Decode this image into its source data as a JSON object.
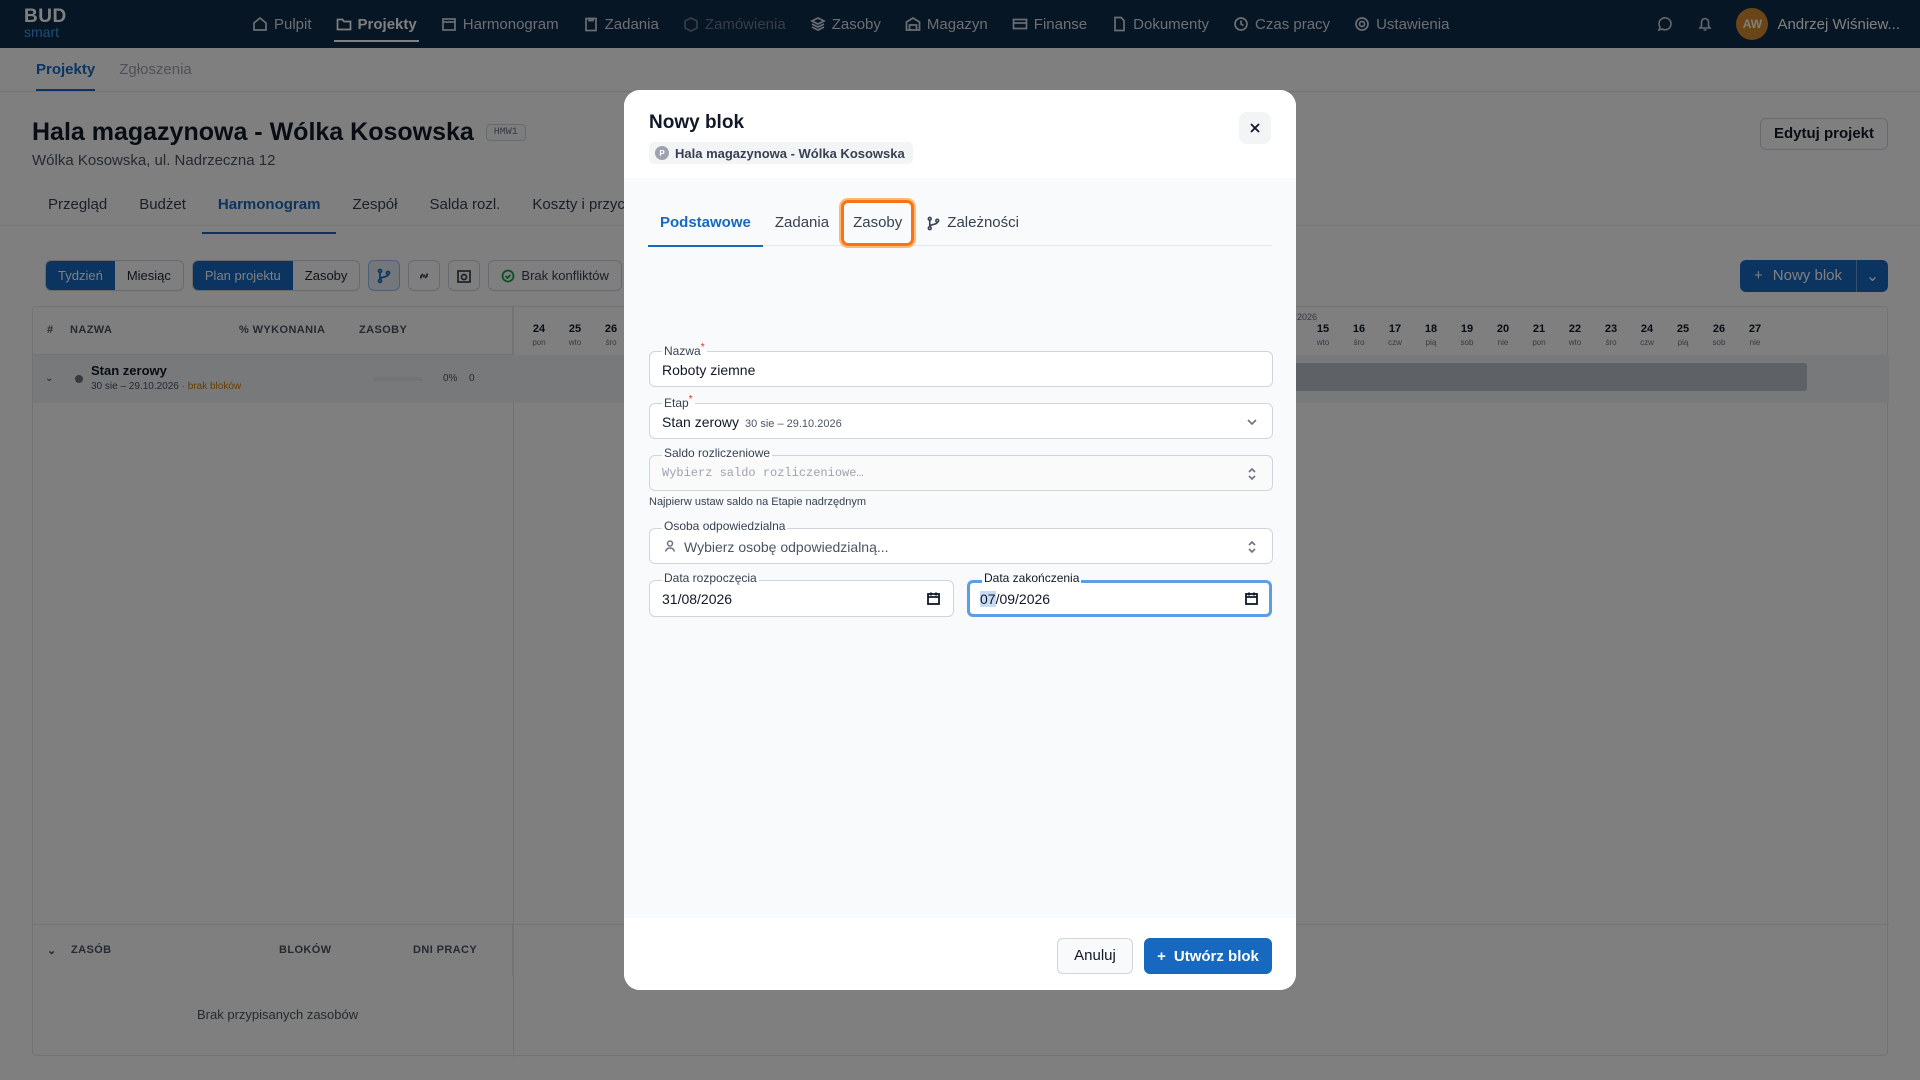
{
  "app": {
    "logo_top": "BUD",
    "logo_bottom": "smart",
    "user_initials": "AW",
    "user_name": "Andrzej Wiśniew..."
  },
  "nav": [
    "Pulpit",
    "Projekty",
    "Harmonogram",
    "Zadania",
    "Zamówienia",
    "Zasoby",
    "Magazyn",
    "Finanse",
    "Dokumenty",
    "Czas pracy",
    "Ustawienia"
  ],
  "subnav": [
    "Projekty",
    "Zgłoszenia"
  ],
  "project": {
    "title": "Hala magazynowa - Wólka Kosowska",
    "code": "HMW1",
    "address": "Wólka Kosowska, ul. Nadrzeczna 12",
    "edit_label": "Edytuj projekt"
  },
  "project_tabs": [
    "Przegląd",
    "Budżet",
    "Harmonogram",
    "Zespół",
    "Salda rozl.",
    "Koszty i przych"
  ],
  "toolbar": {
    "view": [
      "Tydzień",
      "Miesiąc"
    ],
    "mode": [
      "Plan projektu",
      "Zasoby"
    ],
    "conflicts": "Brak konfliktów",
    "new_block": "Nowy blok"
  },
  "grid": {
    "headers": [
      "#",
      "NAZWA",
      "% WYKONANIA",
      "ZASOBY"
    ],
    "stage": {
      "name": "Stan zerowy",
      "dates": "30 sie – 29.10.2026",
      "note": "· brak bloków",
      "pct": "0%",
      "res": "0"
    },
    "year_label": "2026",
    "days_left": [
      {
        "d": "24",
        "w": "pon"
      },
      {
        "d": "25",
        "w": "wto"
      },
      {
        "d": "26",
        "w": "śro"
      }
    ],
    "days_right": [
      {
        "d": "15",
        "w": "wto"
      },
      {
        "d": "16",
        "w": "śro"
      },
      {
        "d": "17",
        "w": "czw"
      },
      {
        "d": "18",
        "w": "pią"
      },
      {
        "d": "19",
        "w": "sob"
      },
      {
        "d": "20",
        "w": "nie"
      },
      {
        "d": "21",
        "w": "pon"
      },
      {
        "d": "22",
        "w": "wto"
      },
      {
        "d": "23",
        "w": "śro"
      },
      {
        "d": "24",
        "w": "czw"
      },
      {
        "d": "25",
        "w": "pią"
      },
      {
        "d": "26",
        "w": "sob"
      },
      {
        "d": "27",
        "w": "nie"
      }
    ],
    "res_headers": [
      "ZASÓB",
      "BLOKÓW",
      "DNI PRACY"
    ],
    "no_resources": "Brak przypisanych zasobów"
  },
  "modal": {
    "title": "Nowy blok",
    "project_chip": "Hala magazynowa - Wólka Kosowska",
    "chip_letter": "P",
    "tabs": [
      "Podstawowe",
      "Zadania",
      "Zasoby",
      "Zależności"
    ],
    "name": {
      "label": "Nazwa",
      "value": "Roboty ziemne"
    },
    "stage": {
      "label": "Etap",
      "value": "Stan zerowy",
      "dates": "30 sie – 29.10.2026"
    },
    "balance": {
      "label": "Saldo rozliczeniowe",
      "placeholder": "Wybierz saldo rozliczeniowe…",
      "hint": "Najpierw ustaw saldo na Etapie nadrzędnym"
    },
    "person": {
      "label": "Osoba odpowiedzialna",
      "placeholder": "Wybierz osobę odpowiedzialną..."
    },
    "start": {
      "label": "Data rozpoczęcia",
      "value": "31/08/2026"
    },
    "end": {
      "label": "Data zakończenia",
      "value_sel": "07",
      "value_rest": "/09/2026"
    },
    "cancel": "Anuluj",
    "create": "Utwórz blok"
  }
}
